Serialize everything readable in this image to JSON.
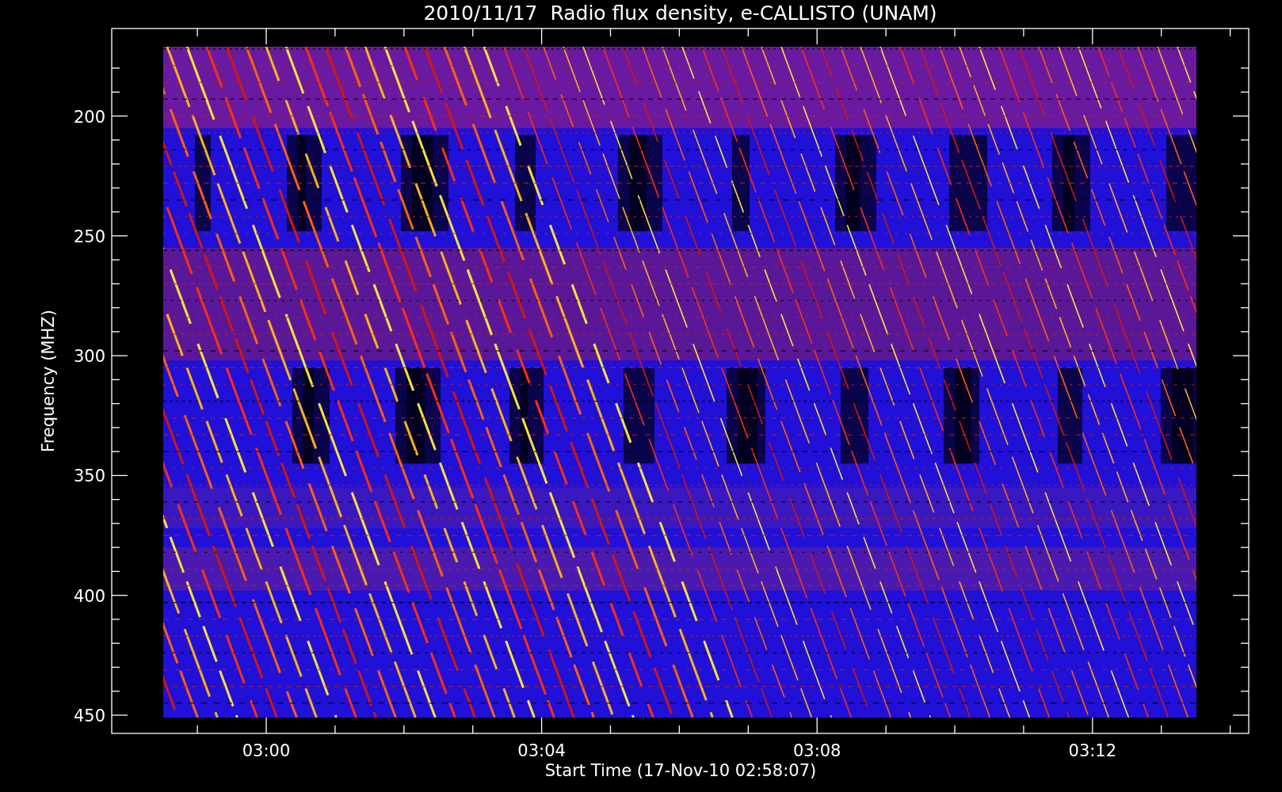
{
  "title": "2010/11/17  Radio flux density, e-CALLISTO (UNAM)",
  "ylabel": "Frequency (MHZ)",
  "xlabel": "Start Time (17-Nov-10 02:58:07)",
  "yticks": [
    "200",
    "250",
    "300",
    "350",
    "400",
    "450"
  ],
  "xticks": [
    "03:00",
    "03:04",
    "03:08",
    "03:12"
  ]
}
